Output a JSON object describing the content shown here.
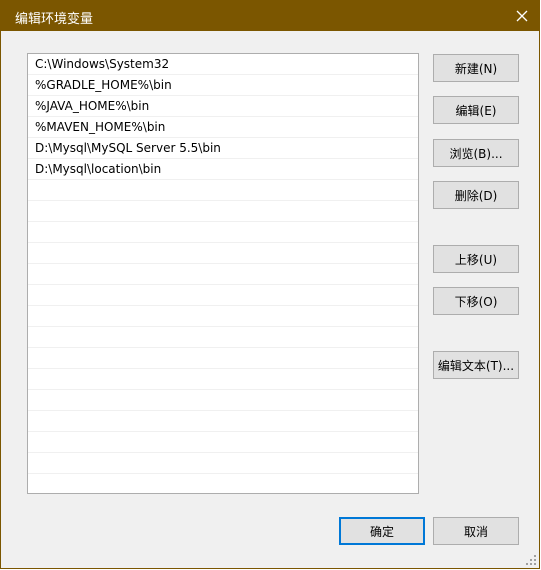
{
  "dialog": {
    "title": "编辑环境变量",
    "close_icon": "close-icon"
  },
  "paths": [
    "C:\\Windows\\System32",
    "%GRADLE_HOME%\\bin",
    "%JAVA_HOME%\\bin",
    "%MAVEN_HOME%\\bin",
    "D:\\Mysql\\MySQL Server 5.5\\bin",
    "D:\\Mysql\\location\\bin"
  ],
  "buttons": {
    "new": "新建(N)",
    "edit": "编辑(E)",
    "browse": "浏览(B)...",
    "delete": "删除(D)",
    "move_up": "上移(U)",
    "move_down": "下移(O)",
    "edit_text": "编辑文本(T)...",
    "ok": "确定",
    "cancel": "取消"
  },
  "colors": {
    "title_bar": "#7b5600",
    "accent": "#0078d7"
  }
}
